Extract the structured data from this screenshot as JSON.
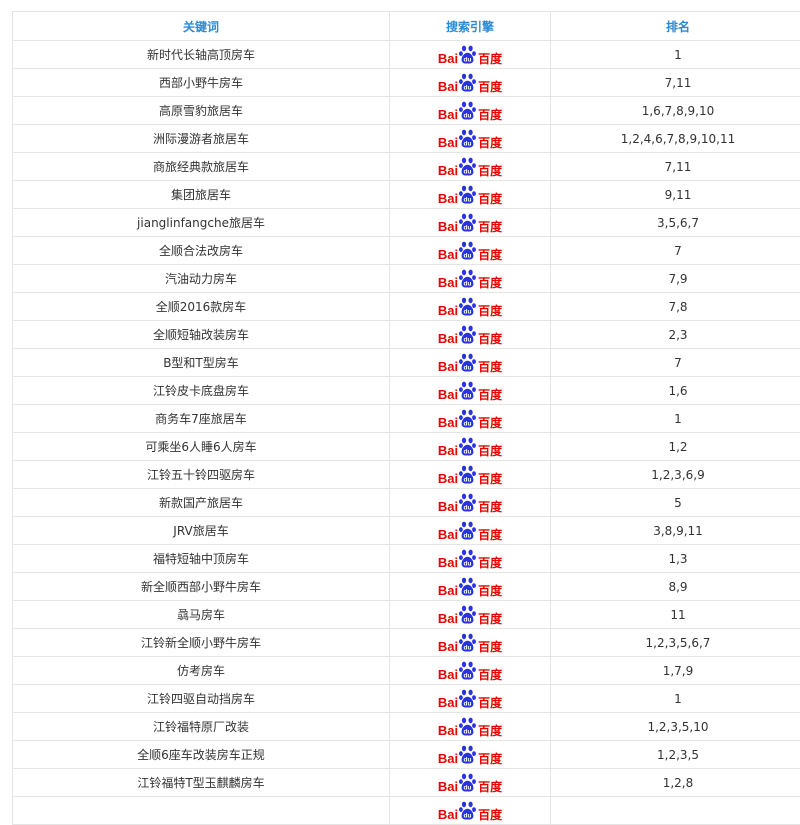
{
  "colors": {
    "header_text": "#2b8ad4",
    "baidu_red": "#e10602",
    "baidu_blue": "#2932e1"
  },
  "table": {
    "headers": {
      "keyword": "关键词",
      "engine": "搜索引擎",
      "rank": "排名"
    },
    "engine_logo": {
      "text_left": "Bai",
      "text_right": "百度",
      "icon": "baidu-paw-icon"
    },
    "rows": [
      {
        "keyword": "新时代长轴高顶房车",
        "rank": "1"
      },
      {
        "keyword": "西部小野牛房车",
        "rank": "7,11"
      },
      {
        "keyword": "高原雪豹旅居车",
        "rank": "1,6,7,8,9,10"
      },
      {
        "keyword": "洲际漫游者旅居车",
        "rank": "1,2,4,6,7,8,9,10,11"
      },
      {
        "keyword": "商旅经典款旅居车",
        "rank": "7,11"
      },
      {
        "keyword": "集团旅居车",
        "rank": "9,11"
      },
      {
        "keyword": "jianglinfangche旅居车",
        "rank": "3,5,6,7"
      },
      {
        "keyword": "全顺合法改房车",
        "rank": "7"
      },
      {
        "keyword": "汽油动力房车",
        "rank": "7,9"
      },
      {
        "keyword": "全顺2016款房车",
        "rank": "7,8"
      },
      {
        "keyword": "全顺短轴改装房车",
        "rank": "2,3"
      },
      {
        "keyword": "B型和T型房车",
        "rank": "7"
      },
      {
        "keyword": "江铃皮卡底盘房车",
        "rank": "1,6"
      },
      {
        "keyword": "商务车7座旅居车",
        "rank": "1"
      },
      {
        "keyword": "可乘坐6人睡6人房车",
        "rank": "1,2"
      },
      {
        "keyword": "江铃五十铃四驱房车",
        "rank": "1,2,3,6,9"
      },
      {
        "keyword": "新款国产旅居车",
        "rank": "5"
      },
      {
        "keyword": "JRV旅居车",
        "rank": "3,8,9,11"
      },
      {
        "keyword": "福特短轴中顶房车",
        "rank": "1,3"
      },
      {
        "keyword": "新全顺西部小野牛房车",
        "rank": "8,9"
      },
      {
        "keyword": "骉马房车",
        "rank": "11"
      },
      {
        "keyword": "江铃新全顺小野牛房车",
        "rank": "1,2,3,5,6,7"
      },
      {
        "keyword": "仿考房车",
        "rank": "1,7,9"
      },
      {
        "keyword": "江铃四驱自动挡房车",
        "rank": "1"
      },
      {
        "keyword": "江铃福特原厂改装",
        "rank": "1,2,3,5,10"
      },
      {
        "keyword": "全顺6座车改装房车正规",
        "rank": "1,2,3,5"
      },
      {
        "keyword": "江铃福特T型玉麒麟房车",
        "rank": "1,2,8"
      },
      {
        "keyword": "",
        "rank": ""
      }
    ]
  }
}
